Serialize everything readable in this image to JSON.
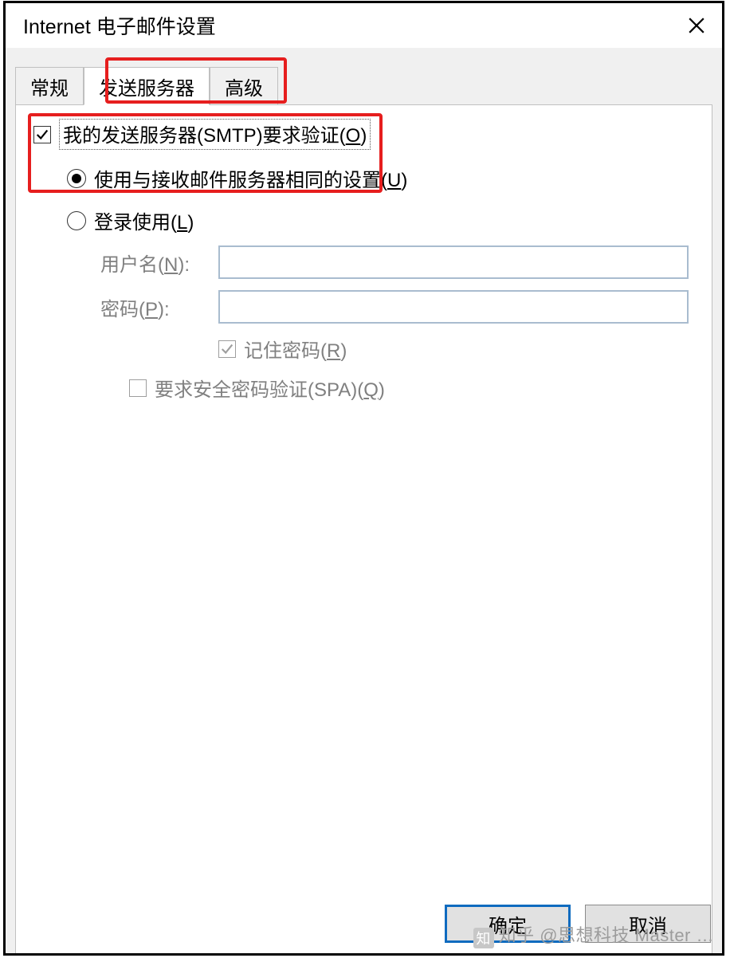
{
  "title": "Internet 电子邮件设置",
  "tabs": [
    {
      "label": "常规"
    },
    {
      "label": "发送服务器"
    },
    {
      "label": "高级"
    }
  ],
  "smtp_auth": {
    "label_pre": "我的发送服务器(SMTP)要求验证(",
    "label_key": "O",
    "label_post": ")",
    "checked": true
  },
  "radio_same": {
    "label_pre": "使用与接收邮件服务器相同的设置(",
    "label_key": "U",
    "label_post": ")",
    "selected": true
  },
  "radio_login": {
    "label_pre": "登录使用(",
    "label_key": "L",
    "label_post": ")",
    "selected": false
  },
  "fields": {
    "username_label_pre": "用户名(",
    "username_label_key": "N",
    "username_label_post": "):",
    "username_value": "",
    "password_label_pre": "密码(",
    "password_label_key": "P",
    "password_label_post": "):",
    "password_value": ""
  },
  "remember": {
    "label_pre": "记住密码(",
    "label_key": "R",
    "label_post": ")",
    "checked": true
  },
  "spa": {
    "label_pre": "要求安全密码验证(SPA)(",
    "label_key": "Q",
    "label_post": ")",
    "checked": false
  },
  "buttons": {
    "ok": "确定",
    "cancel": "取消"
  },
  "watermark": "知乎 @思想科技 Master …"
}
